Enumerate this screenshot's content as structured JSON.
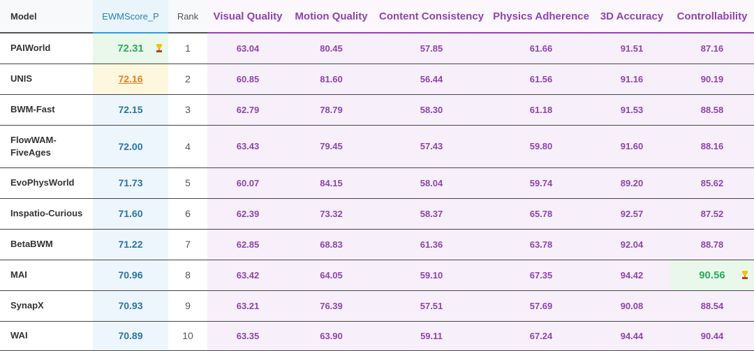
{
  "headers": {
    "model": "Model",
    "ewm": "EWMScore_P",
    "rank": "Rank",
    "visual": "Visual Quality",
    "motion": "Motion Quality",
    "content": "Content Consistency",
    "physics": "Physics Adherence",
    "accuracy3d": "3D Accuracy",
    "control": "Controllability"
  },
  "rows": [
    {
      "model": "PAIWorld",
      "ewm": "72.31",
      "rank": "1",
      "visual": "63.04",
      "motion": "80.45",
      "content": "57.85",
      "physics": "61.66",
      "accuracy3d": "91.51",
      "control": "87.16"
    },
    {
      "model": "UNIS",
      "ewm": "72.16",
      "rank": "2",
      "visual": "60.85",
      "motion": "81.60",
      "content": "56.44",
      "physics": "61.56",
      "accuracy3d": "91.16",
      "control": "90.19"
    },
    {
      "model": "BWM-Fast",
      "ewm": "72.15",
      "rank": "3",
      "visual": "62.79",
      "motion": "78.79",
      "content": "58.30",
      "physics": "61.18",
      "accuracy3d": "91.53",
      "control": "88.58"
    },
    {
      "model": "FlowWAM-FiveAges",
      "ewm": "72.00",
      "rank": "4",
      "visual": "63.43",
      "motion": "79.45",
      "content": "57.43",
      "physics": "59.80",
      "accuracy3d": "91.60",
      "control": "88.16"
    },
    {
      "model": "EvoPhysWorld",
      "ewm": "71.73",
      "rank": "5",
      "visual": "60.07",
      "motion": "84.15",
      "content": "58.04",
      "physics": "59.74",
      "accuracy3d": "89.20",
      "control": "85.62"
    },
    {
      "model": "Inspatio-Curious",
      "ewm": "71.60",
      "rank": "6",
      "visual": "62.39",
      "motion": "73.32",
      "content": "58.37",
      "physics": "65.78",
      "accuracy3d": "92.57",
      "control": "87.52"
    },
    {
      "model": "BetaBWM",
      "ewm": "71.22",
      "rank": "7",
      "visual": "62.85",
      "motion": "68.83",
      "content": "61.36",
      "physics": "63.78",
      "accuracy3d": "92.04",
      "control": "88.78"
    },
    {
      "model": "MAI",
      "ewm": "70.96",
      "rank": "8",
      "visual": "63.42",
      "motion": "64.05",
      "content": "59.10",
      "physics": "67.35",
      "accuracy3d": "94.42",
      "control": "90.56"
    },
    {
      "model": "SynapX",
      "ewm": "70.93",
      "rank": "9",
      "visual": "63.21",
      "motion": "76.39",
      "content": "57.51",
      "physics": "57.69",
      "accuracy3d": "90.08",
      "control": "88.54"
    },
    {
      "model": "WAI",
      "ewm": "70.89",
      "rank": "10",
      "visual": "63.35",
      "motion": "63.90",
      "content": "59.11",
      "physics": "67.24",
      "accuracy3d": "94.44",
      "control": "90.44"
    }
  ],
  "colors": {
    "metric_text": "#8e44ad",
    "ewm_text": "#2874a6",
    "best_text": "#27ae60",
    "second_text": "#e67e22",
    "best_bg": "#e9f8ea",
    "second_bg": "#fcf7dd"
  },
  "icons": {
    "best_marker": "trophy-icon"
  }
}
